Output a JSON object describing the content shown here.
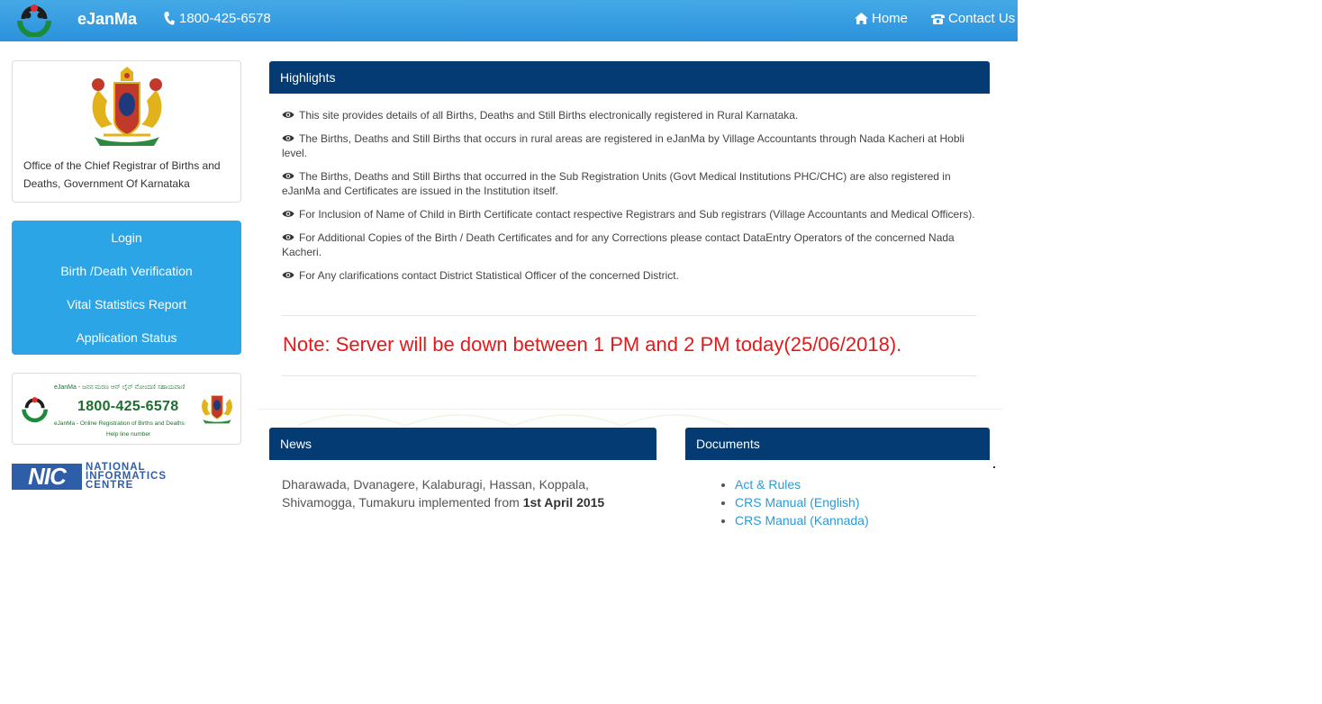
{
  "navbar": {
    "brand": "eJanMa",
    "phone": "1800-425-6578",
    "home_label": "Home",
    "contact_label": "Contact Us",
    "bg_color": "#2b92dc"
  },
  "sidebar": {
    "office_text": "Office of the Chief Registrar of Births and Deaths, Government Of Karnataka",
    "menu": [
      {
        "label": "Login"
      },
      {
        "label": "Birth /Death Verification"
      },
      {
        "label": "Vital Statistics Report"
      },
      {
        "label": "Application Status"
      }
    ],
    "helpline_banner": {
      "top_text": "eJanMa - ಜನನ ಮರಣ ಆನ್ ಲೈನ್ ನೋಂದಣಿ ಸಹಾಯವಾಣಿ",
      "number": "1800-425-6578",
      "sub_text": "eJanMa - Online Registration of Births and Deaths",
      "help_text": "Help line number"
    },
    "nic": {
      "abbr": "NIC",
      "line1": "NATIONAL",
      "line2": "INFORMATICS",
      "line3": "CENTRE"
    }
  },
  "highlights": {
    "title": "Highlights",
    "items": [
      "This site provides details of all Births, Deaths and Still Births electronically registered in Rural Karnataka.",
      "The Births, Deaths and Still Births that occurs in rural areas are registered in eJanMa by Village Accountants through Nada Kacheri at Hobli level.",
      "The Births, Deaths and Still Births that occurred in the Sub Registration Units (Govt Medical Institutions PHC/CHC) are also registered in eJanMa and Certificates are issued in the Institution itself.",
      "For Inclusion of Name of Child in Birth Certificate contact respective Registrars and Sub registrars (Village Accountants and Medical Officers).",
      "For Additional Copies of the Birth / Death Certificates and for any Corrections please contact DataEntry Operators of the concerned Nada Kacheri.",
      "For Any clarifications contact District Statistical Officer of the concerned District."
    ],
    "note": "Note: Server will be down between 1 PM and 2 PM today(25/06/2018).",
    "note_color": "#e31a1a",
    "header_color": "#043b72"
  },
  "news": {
    "title": "News",
    "line2": "Dharawada, Dvanagere, Kalaburagi, Hassan, Koppala,",
    "line3_prefix": "Shivamogga, Tumakuru implemented from ",
    "line3_bold": "1st April 2015"
  },
  "documents": {
    "title": "Documents",
    "links": [
      {
        "label": "Act & Rules"
      },
      {
        "label": "CRS Manual (English)"
      },
      {
        "label": "CRS Manual (Kannada)"
      }
    ],
    "link_color": "#2a9ad8"
  }
}
